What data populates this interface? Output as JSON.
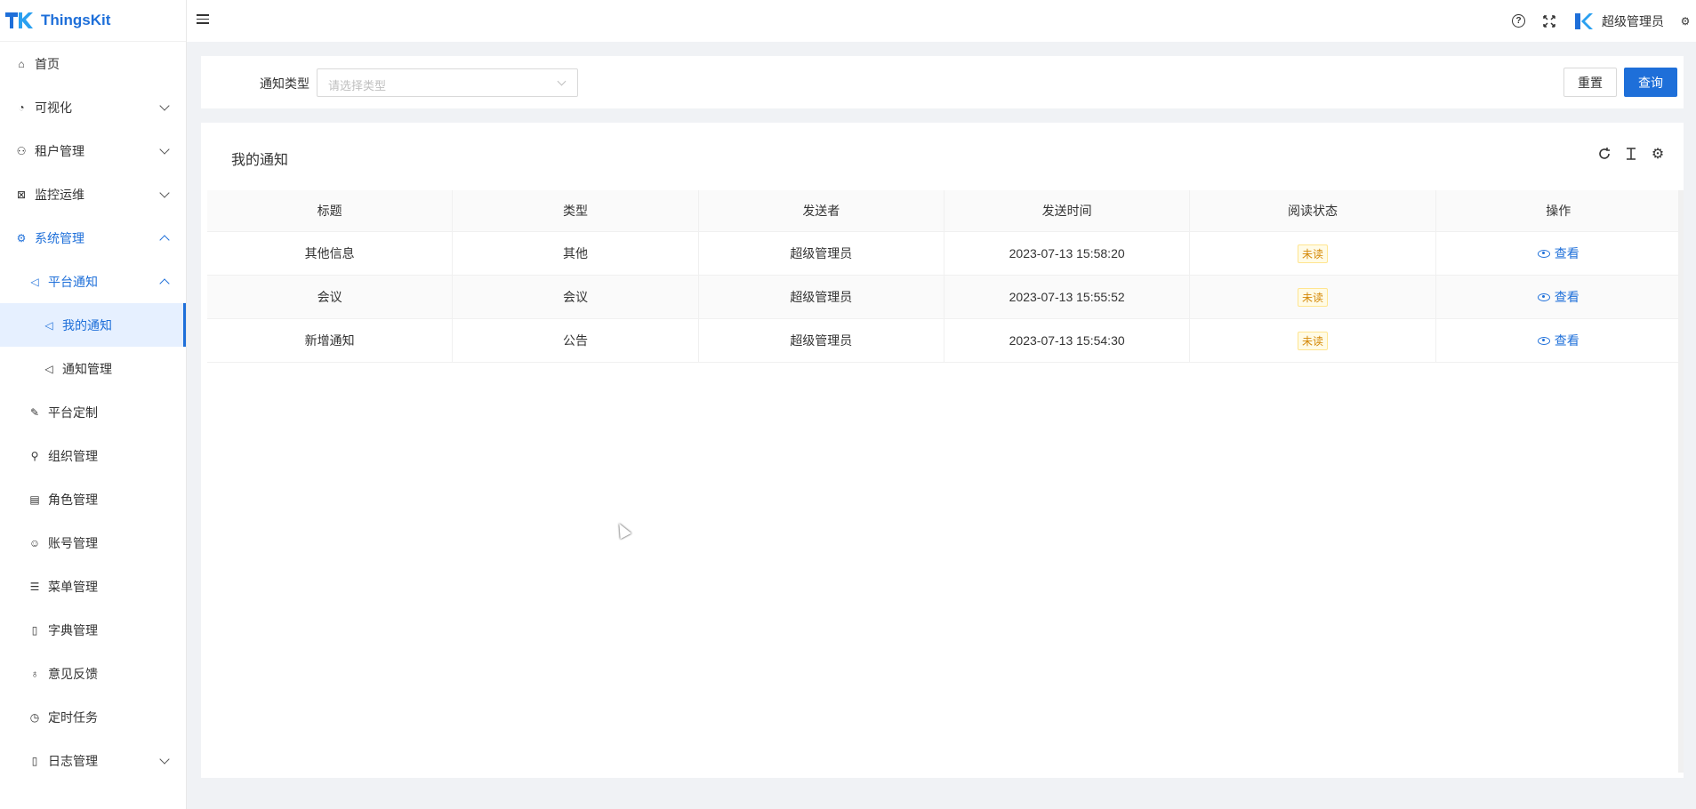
{
  "app": {
    "name": "ThingsKit"
  },
  "header": {
    "username": "超级管理员"
  },
  "sidebar": {
    "items": [
      {
        "label": "首页",
        "icon": "home-icon",
        "level": 1
      },
      {
        "label": "可视化",
        "icon": "dashboard-icon",
        "level": 1,
        "expandable": true
      },
      {
        "label": "租户管理",
        "icon": "users-icon",
        "level": 1,
        "expandable": true
      },
      {
        "label": "监控运维",
        "icon": "monitor-icon",
        "level": 1,
        "expandable": true
      },
      {
        "label": "系统管理",
        "icon": "gear-icon",
        "level": 1,
        "expandable": true,
        "expanded": true
      },
      {
        "label": "平台通知",
        "icon": "megaphone-icon",
        "level": 2,
        "expandable": true,
        "expanded": true
      },
      {
        "label": "我的通知",
        "icon": "megaphone-icon",
        "level": 3,
        "active": true
      },
      {
        "label": "通知管理",
        "icon": "speaker-icon",
        "level": 3
      },
      {
        "label": "平台定制",
        "icon": "edit-icon",
        "level": 2
      },
      {
        "label": "组织管理",
        "icon": "org-icon",
        "level": 2
      },
      {
        "label": "角色管理",
        "icon": "idcard-icon",
        "level": 2
      },
      {
        "label": "账号管理",
        "icon": "user-icon",
        "level": 2
      },
      {
        "label": "菜单管理",
        "icon": "menu-icon",
        "level": 2
      },
      {
        "label": "字典管理",
        "icon": "file-icon",
        "level": 2
      },
      {
        "label": "意见反馈",
        "icon": "bulb-icon",
        "level": 2
      },
      {
        "label": "定时任务",
        "icon": "clock-icon",
        "level": 2
      },
      {
        "label": "日志管理",
        "icon": "file-icon",
        "level": 2,
        "expandable": true
      }
    ]
  },
  "search": {
    "label": "通知类型",
    "placeholder": "请选择类型",
    "reset_label": "重置",
    "query_label": "查询"
  },
  "table": {
    "title": "我的通知",
    "columns": [
      "标题",
      "类型",
      "发送者",
      "发送时间",
      "阅读状态",
      "操作"
    ],
    "rows": [
      {
        "title": "其他信息",
        "type": "其他",
        "sender": "超级管理员",
        "time": "2023-07-13 15:58:20",
        "status": "未读",
        "action": "查看"
      },
      {
        "title": "会议",
        "type": "会议",
        "sender": "超级管理员",
        "time": "2023-07-13 15:55:52",
        "status": "未读",
        "action": "查看"
      },
      {
        "title": "新增通知",
        "type": "公告",
        "sender": "超级管理员",
        "time": "2023-07-13 15:54:30",
        "status": "未读",
        "action": "查看"
      }
    ]
  },
  "colors": {
    "accent": "#1e6fd9",
    "tag_bg": "#fffbe6",
    "tag_text": "#d48806"
  }
}
